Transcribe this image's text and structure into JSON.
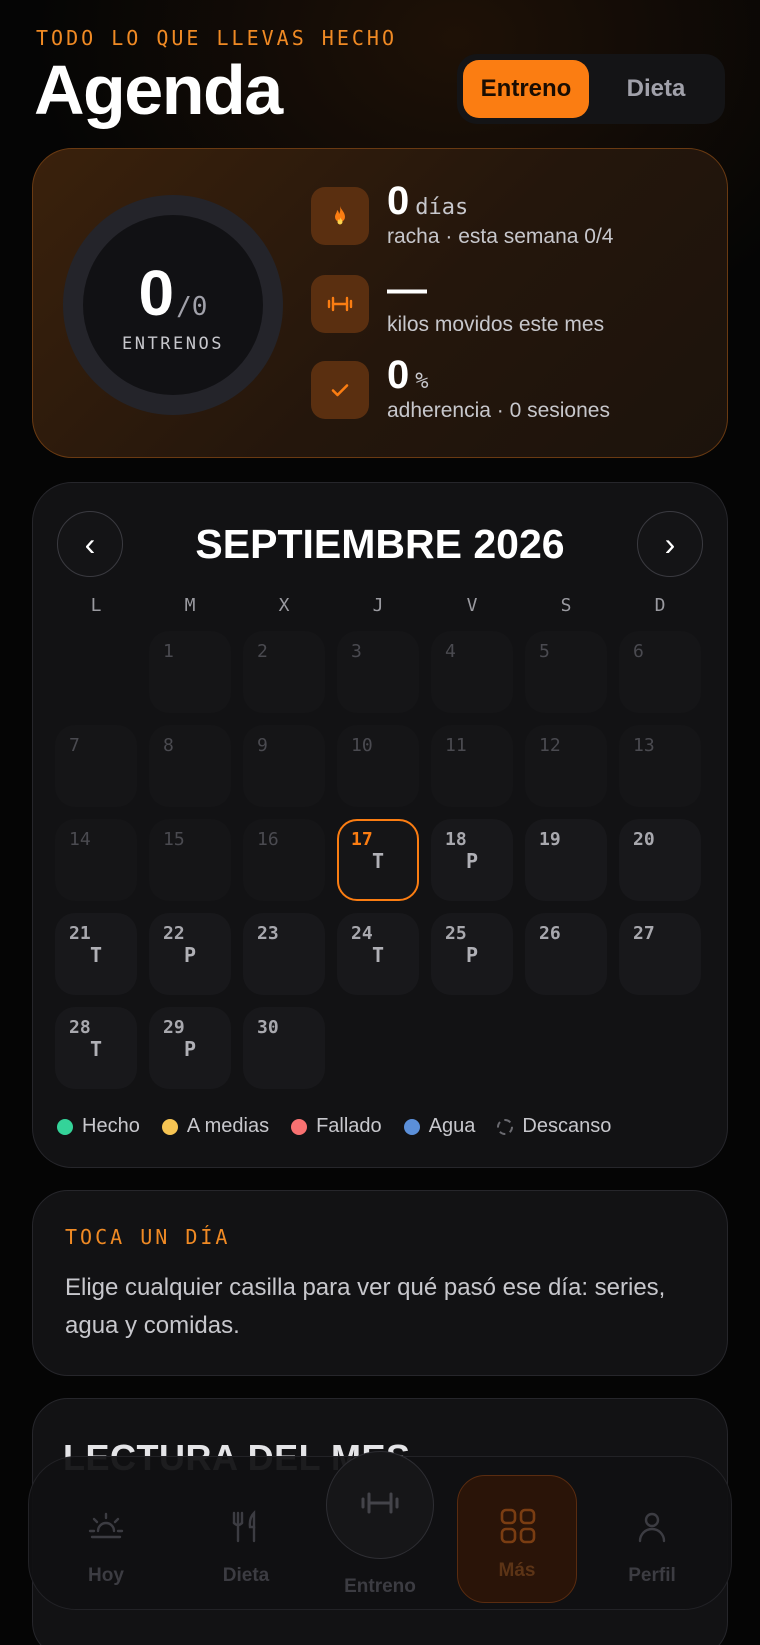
{
  "header": {
    "eyebrow": "TODO LO QUE LLEVAS HECHO",
    "title": "Agenda",
    "segments": [
      {
        "label": "Entreno",
        "active": true
      },
      {
        "label": "Dieta",
        "active": false
      }
    ]
  },
  "summary": {
    "ring": {
      "done": "0",
      "total": "/0",
      "label": "ENTRENOS"
    },
    "stats": [
      {
        "icon": "flame-icon",
        "value": "0",
        "unit": "días",
        "desc": "racha · esta semana 0/4"
      },
      {
        "icon": "dumbbell-icon",
        "value": "—",
        "unit": "",
        "desc": "kilos movidos este mes"
      },
      {
        "icon": "check-icon",
        "value": "0",
        "unit": "%",
        "desc": "adherencia · 0 sesiones"
      }
    ]
  },
  "calendar": {
    "month_title": "SEPTIEMBRE 2026",
    "prev_glyph": "‹",
    "next_glyph": "›",
    "weekdays": [
      "L",
      "M",
      "X",
      "J",
      "V",
      "S",
      "D"
    ],
    "leading_blanks": 1,
    "days": [
      {
        "n": "1",
        "state": "past",
        "tag": ""
      },
      {
        "n": "2",
        "state": "past",
        "tag": ""
      },
      {
        "n": "3",
        "state": "past",
        "tag": ""
      },
      {
        "n": "4",
        "state": "past",
        "tag": ""
      },
      {
        "n": "5",
        "state": "past",
        "tag": ""
      },
      {
        "n": "6",
        "state": "past",
        "tag": ""
      },
      {
        "n": "7",
        "state": "past",
        "tag": ""
      },
      {
        "n": "8",
        "state": "past",
        "tag": ""
      },
      {
        "n": "9",
        "state": "past",
        "tag": ""
      },
      {
        "n": "10",
        "state": "past",
        "tag": ""
      },
      {
        "n": "11",
        "state": "past",
        "tag": ""
      },
      {
        "n": "12",
        "state": "past",
        "tag": ""
      },
      {
        "n": "13",
        "state": "past",
        "tag": ""
      },
      {
        "n": "14",
        "state": "past",
        "tag": ""
      },
      {
        "n": "15",
        "state": "past",
        "tag": ""
      },
      {
        "n": "16",
        "state": "past",
        "tag": ""
      },
      {
        "n": "17",
        "state": "today",
        "tag": "T"
      },
      {
        "n": "18",
        "state": "future",
        "tag": "P"
      },
      {
        "n": "19",
        "state": "future",
        "tag": ""
      },
      {
        "n": "20",
        "state": "future",
        "tag": ""
      },
      {
        "n": "21",
        "state": "future",
        "tag": "T"
      },
      {
        "n": "22",
        "state": "future",
        "tag": "P"
      },
      {
        "n": "23",
        "state": "future",
        "tag": ""
      },
      {
        "n": "24",
        "state": "future",
        "tag": "T"
      },
      {
        "n": "25",
        "state": "future",
        "tag": "P"
      },
      {
        "n": "26",
        "state": "future",
        "tag": ""
      },
      {
        "n": "27",
        "state": "future",
        "tag": ""
      },
      {
        "n": "28",
        "state": "future",
        "tag": "T"
      },
      {
        "n": "29",
        "state": "future",
        "tag": "P"
      },
      {
        "n": "30",
        "state": "future",
        "tag": ""
      }
    ],
    "legend": [
      {
        "label": "Hecho",
        "color": "#34d399"
      },
      {
        "label": "A medias",
        "color": "#f6c453"
      },
      {
        "label": "Fallado",
        "color": "#f87171"
      },
      {
        "label": "Agua",
        "color": "#5b8fd9"
      },
      {
        "label": "Descanso",
        "color": "dashed"
      }
    ]
  },
  "info": {
    "title": "TOCA UN DÍA",
    "body": "Elige cualquier casilla para ver qué pasó ese día: series, agua y comidas."
  },
  "peek": {
    "title": "LECTURA DEL MES"
  },
  "nav": {
    "items": [
      {
        "label": "Hoy",
        "icon": "sunrise-icon"
      },
      {
        "label": "Dieta",
        "icon": "fork-knife-icon"
      },
      {
        "label": "Entreno",
        "icon": "dumbbell-icon"
      },
      {
        "label": "Más",
        "icon": "grid-icon",
        "active": true
      },
      {
        "label": "Perfil",
        "icon": "person-icon"
      }
    ]
  },
  "colors": {
    "accent": "#fb7d12",
    "background": "#050505",
    "card": "#121214"
  }
}
